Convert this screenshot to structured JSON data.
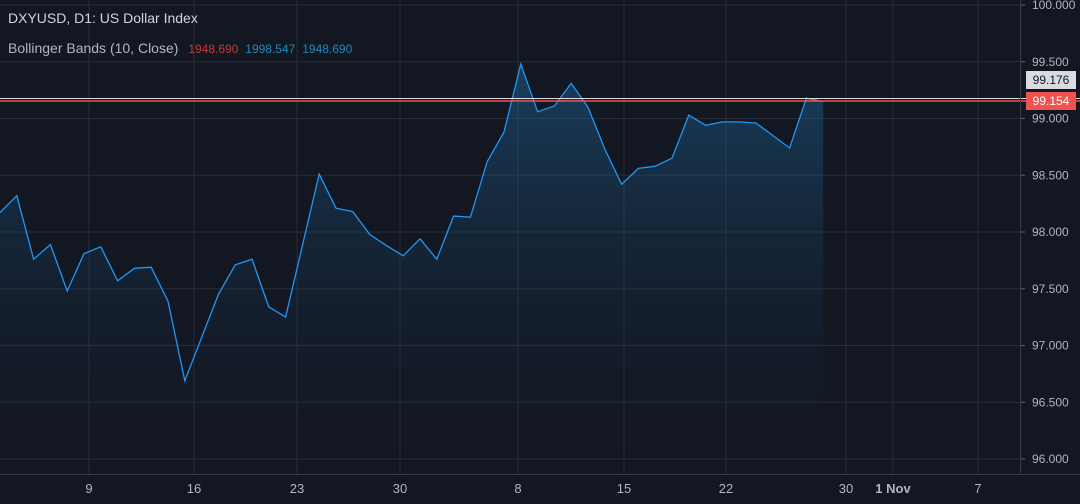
{
  "header": {
    "symbol_title": "DXYUSD, D1: US Dollar Index",
    "indicator_name": "Bollinger Bands (10, Close)",
    "indicator_values": [
      "1948.690",
      "1998.547",
      "1948.690"
    ]
  },
  "price_tags": {
    "upper": "99.176",
    "last": "99.154"
  },
  "colors": {
    "background": "#131722",
    "grid": "#2a2e39",
    "line": "#2196f3",
    "last_price": "#ef5350",
    "band_red": "#c53a3a",
    "band_blue": "#1f8ac0"
  },
  "chart_data": {
    "type": "area",
    "title": "DXYUSD, D1: US Dollar Index",
    "x_tick_labels": [
      "9",
      "16",
      "23",
      "30",
      "8",
      "15",
      "22",
      "30",
      "1 Nov",
      "7"
    ],
    "y_tick_labels": [
      "96.000",
      "96.500",
      "97.000",
      "97.500",
      "98.000",
      "98.500",
      "99.000",
      "99.500",
      "100.000"
    ],
    "ylim": [
      96.0,
      100.0
    ],
    "grid": true,
    "horizontal_lines": [
      99.176,
      99.154
    ],
    "series": [
      {
        "values": [
          98.17,
          98.32,
          97.76,
          97.89,
          97.48,
          97.81,
          97.87,
          97.57,
          97.68,
          97.69,
          97.39,
          96.69,
          97.07,
          97.45,
          97.71,
          97.76,
          97.34,
          97.25,
          97.88,
          98.51,
          98.21,
          98.18,
          97.98,
          97.88,
          97.79,
          97.94,
          97.76,
          98.14,
          98.13,
          98.62,
          98.88,
          99.48,
          99.06,
          99.11,
          99.31,
          99.1,
          98.73,
          98.42,
          98.56,
          98.58,
          98.65,
          99.03,
          98.94,
          98.97,
          98.97,
          98.96,
          98.85,
          98.74,
          99.18,
          99.15
        ]
      }
    ]
  }
}
